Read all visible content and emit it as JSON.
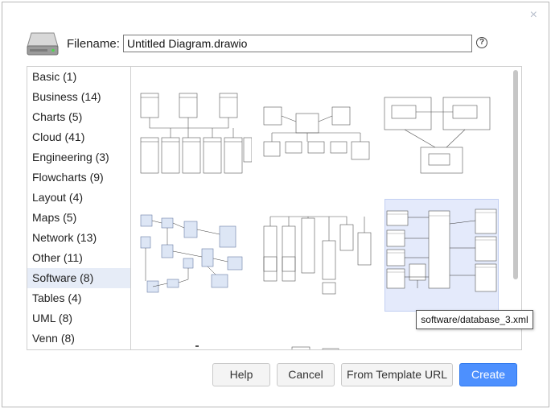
{
  "dialog": {
    "filename_label": "Filename:",
    "filename_value": "Untitled Diagram.drawio",
    "help_icon_glyph": "?",
    "close_glyph": "×"
  },
  "categories": [
    {
      "label": "Basic (1)"
    },
    {
      "label": "Business (14)"
    },
    {
      "label": "Charts (5)"
    },
    {
      "label": "Cloud (41)"
    },
    {
      "label": "Engineering (3)"
    },
    {
      "label": "Flowcharts (9)"
    },
    {
      "label": "Layout (4)"
    },
    {
      "label": "Maps (5)"
    },
    {
      "label": "Network (13)"
    },
    {
      "label": "Other (11)"
    },
    {
      "label": "Software (8)",
      "selected": true
    },
    {
      "label": "Tables (4)"
    },
    {
      "label": "UML (8)"
    },
    {
      "label": "Venn (8)"
    }
  ],
  "tooltip": "software/database_3.xml",
  "buttons": {
    "help": "Help",
    "cancel": "Cancel",
    "template_url": "From Template URL",
    "create": "Create"
  },
  "colors": {
    "primary": "#4d90fe",
    "selected_category": "#e6ecf7",
    "selected_thumb": "#e4eafb"
  }
}
